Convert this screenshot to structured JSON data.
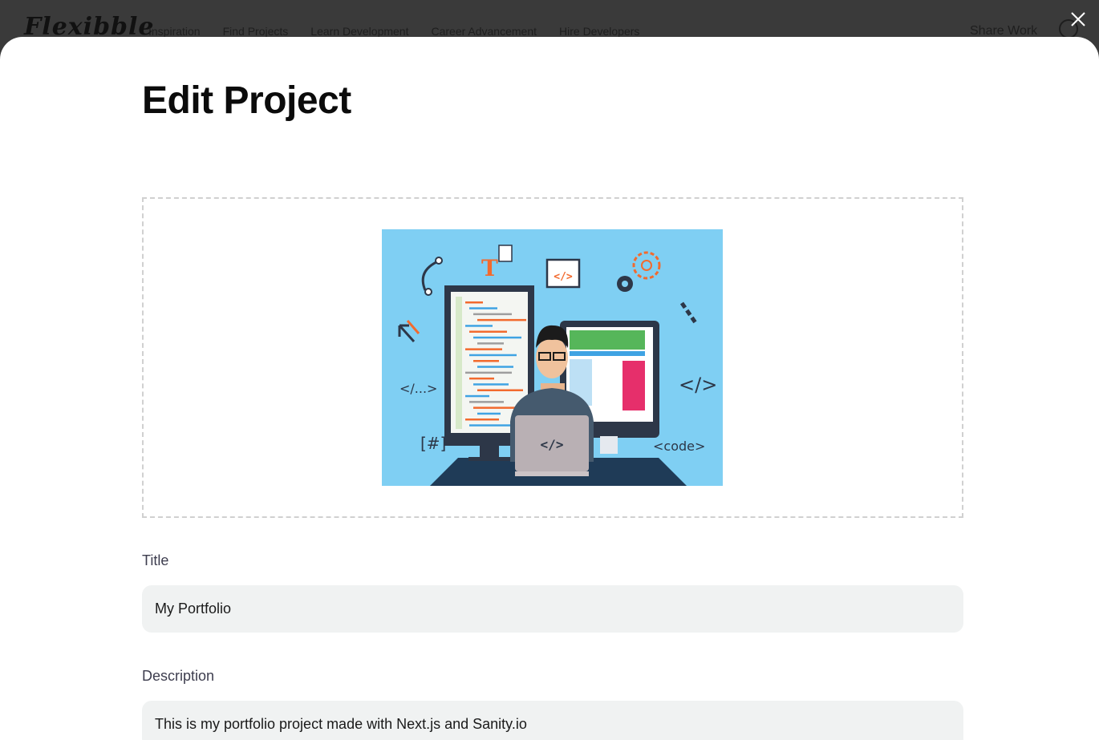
{
  "navbar": {
    "logo": "Flexibble",
    "links": [
      "Inspiration",
      "Find Projects",
      "Learn Development",
      "Career Advancement",
      "Hire Developers"
    ],
    "share_work": "Share Work"
  },
  "modal": {
    "title": "Edit Project",
    "image_tags": {
      "code_small": "</...>",
      "hash": "[#]",
      "code_tag": "</>",
      "code_word": "<code>",
      "laptop": "</>",
      "window": "</>",
      "T": "T"
    },
    "fields": {
      "title": {
        "label": "Title",
        "value": "My Portfolio"
      },
      "description": {
        "label": "Description",
        "value": "This is my portfolio project made with Next.js and Sanity.io"
      }
    }
  },
  "colors": {
    "overlay": "#3a3a3a",
    "modal_bg": "#ffffff",
    "input_bg": "#f0f2f2",
    "preview_bg": "#7fcff3",
    "accent_orange": "#f26a2e",
    "navy": "#1f3b57"
  }
}
